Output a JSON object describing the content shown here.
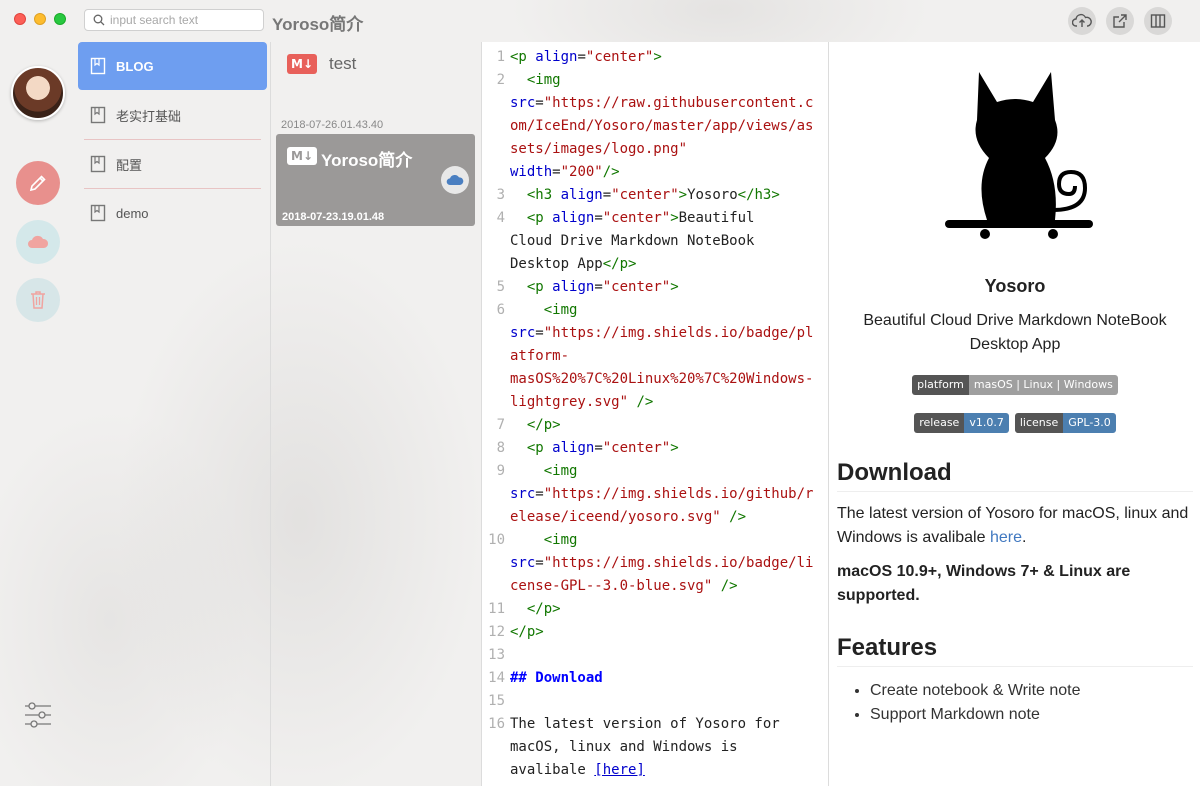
{
  "window": {
    "title": "Yoroso简介"
  },
  "search": {
    "placeholder": "input search text"
  },
  "toolbar": {
    "icons": [
      "cloud-upload-icon",
      "share-icon",
      "columns-icon"
    ]
  },
  "rail": {
    "icons": [
      "avatar",
      "edit-icon",
      "cloud-icon",
      "trash-icon",
      "settings-sliders-icon"
    ]
  },
  "notebooks": [
    {
      "label": "BLOG",
      "active": true
    },
    {
      "label": "老实打基础",
      "active": false
    },
    {
      "label": "配置",
      "active": false
    },
    {
      "label": "demo",
      "active": false
    }
  ],
  "notes": {
    "header": "test",
    "md_badge": "M↓",
    "list": [
      {
        "created": "2018-07-26.01.43.40",
        "title": "Yoroso简介",
        "updated": "2018-07-23.19.01.48"
      }
    ]
  },
  "editor": {
    "lines": [
      {
        "n": "1",
        "html": "<span class='tg'>&lt;p</span> <span class='at'>align</span>=<span class='st'>\"center\"</span><span class='tg'>&gt;</span>"
      },
      {
        "n": "2",
        "html": "  <span class='tg'>&lt;img</span>\n<span class='at'>src</span>=<span class='st'>\"https://raw.githubusercontent.com/IceEnd/Yosoro/master/app/views/assets/images/logo.png\"</span>\n<span class='at'>width</span>=<span class='st'>\"200\"</span><span class='tg'>/&gt;</span>"
      },
      {
        "n": "3",
        "html": "  <span class='tg'>&lt;h3</span> <span class='at'>align</span>=<span class='st'>\"center\"</span><span class='tg'>&gt;</span>Yosoro<span class='tg'>&lt;/h3&gt;</span>"
      },
      {
        "n": "4",
        "html": "  <span class='tg'>&lt;p</span> <span class='at'>align</span>=<span class='st'>\"center\"</span><span class='tg'>&gt;</span>Beautiful\nCloud Drive Markdown NoteBook\nDesktop App<span class='tg'>&lt;/p&gt;</span>"
      },
      {
        "n": "5",
        "html": "  <span class='tg'>&lt;p</span> <span class='at'>align</span>=<span class='st'>\"center\"</span><span class='tg'>&gt;</span>"
      },
      {
        "n": "6",
        "html": "    <span class='tg'>&lt;img</span>\n<span class='at'>src</span>=<span class='st'>\"https://img.shields.io/badge/platform-\nmasOS%20%7C%20Linux%20%7C%20Windows-lightgrey.svg\"</span> <span class='tg'>/&gt;</span>"
      },
      {
        "n": "7",
        "html": "  <span class='tg'>&lt;/p&gt;</span>"
      },
      {
        "n": "8",
        "html": "  <span class='tg'>&lt;p</span> <span class='at'>align</span>=<span class='st'>\"center\"</span><span class='tg'>&gt;</span>"
      },
      {
        "n": "9",
        "html": "    <span class='tg'>&lt;img</span>\n<span class='at'>src</span>=<span class='st'>\"https://img.shields.io/github/release/iceend/yosoro.svg\"</span> <span class='tg'>/&gt;</span>"
      },
      {
        "n": "10",
        "html": "    <span class='tg'>&lt;img</span>\n<span class='at'>src</span>=<span class='st'>\"https://img.shields.io/badge/license-GPL--3.0-blue.svg\"</span> <span class='tg'>/&gt;</span>"
      },
      {
        "n": "11",
        "html": "  <span class='tg'>&lt;/p&gt;</span>"
      },
      {
        "n": "12",
        "html": "<span class='tg'>&lt;/p&gt;</span>"
      },
      {
        "n": "13",
        "html": ""
      },
      {
        "n": "14",
        "html": "<span class='hd'>## Download</span>"
      },
      {
        "n": "15",
        "html": ""
      },
      {
        "n": "16",
        "html": "The latest version of Yosoro for\nmacOS, linux and Windows is\navalibale <span class='lk'>[here]</span>"
      }
    ]
  },
  "preview": {
    "h3": "Yosoro",
    "desc": "Beautiful Cloud Drive Markdown NoteBook Desktop App",
    "shields": [
      [
        {
          "l": "platform",
          "r": "masOS | Linux | Windows",
          "color": "#9f9f9f"
        }
      ],
      [
        {
          "l": "release",
          "r": "v1.0.7",
          "color": "#4c7fb0"
        },
        {
          "l": "license",
          "r": "GPL-3.0",
          "color": "#4c7fb0"
        }
      ]
    ],
    "download_heading": "Download",
    "download_text": "The latest version of Yosoro for macOS, linux and Windows is avalibale ",
    "download_link": "here",
    "download_period": ".",
    "requirements": "macOS 10.9+, Windows 7+ & Linux are supported.",
    "features_heading": "Features",
    "features": [
      "Create notebook & Write note",
      "Support Markdown note"
    ]
  },
  "colors": {
    "accent": "#6e9ef0",
    "edit": "#e8908d"
  }
}
